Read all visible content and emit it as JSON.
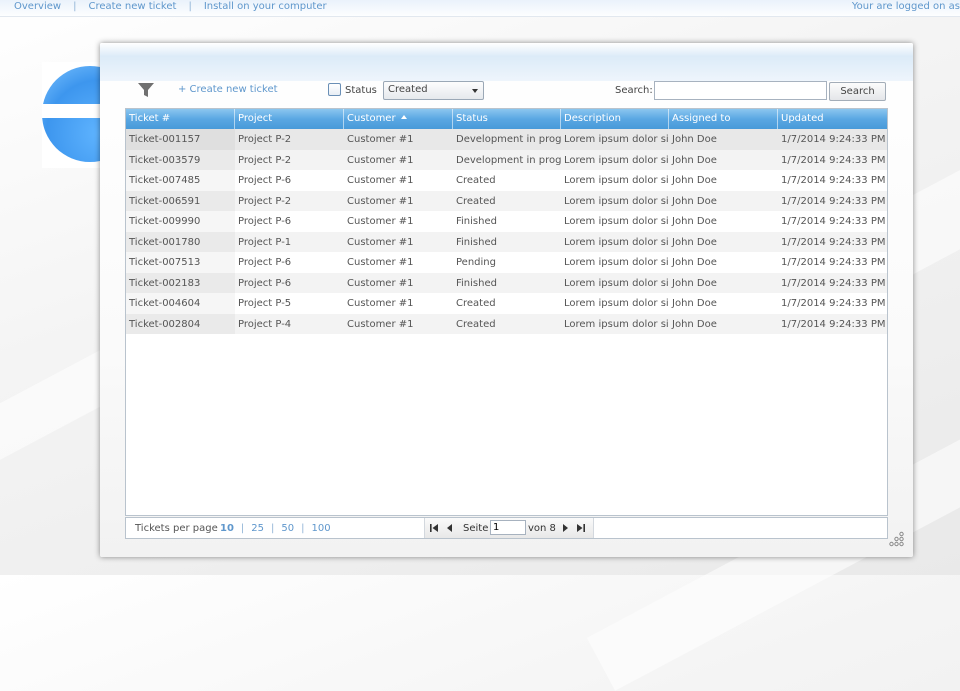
{
  "nav": {
    "links": [
      "Overview",
      "Create new ticket",
      "Install on your computer"
    ],
    "logged_in_text": "Your are logged on as"
  },
  "toolbar": {
    "create_link": "+ Create new ticket",
    "status_label": "Status",
    "status_selected": "Created",
    "search_label": "Search:",
    "search_value": "",
    "search_button": "Search"
  },
  "grid": {
    "columns": [
      "Ticket #",
      "Project",
      "Customer",
      "Status",
      "Description",
      "Assigned to",
      "Updated"
    ],
    "sorted_column": "Customer",
    "rows": [
      [
        "Ticket-001157",
        "Project P-2",
        "Customer #1",
        "Development in progress",
        "Lorem ipsum dolor sit",
        "John Doe",
        "1/7/2014 9:24:33 PM"
      ],
      [
        "Ticket-003579",
        "Project P-2",
        "Customer #1",
        "Development in progress",
        "Lorem ipsum dolor sit",
        "John Doe",
        "1/7/2014 9:24:33 PM"
      ],
      [
        "Ticket-007485",
        "Project P-6",
        "Customer #1",
        "Created",
        "Lorem ipsum dolor sit",
        "John Doe",
        "1/7/2014 9:24:33 PM"
      ],
      [
        "Ticket-006591",
        "Project P-2",
        "Customer #1",
        "Created",
        "Lorem ipsum dolor sit",
        "John Doe",
        "1/7/2014 9:24:33 PM"
      ],
      [
        "Ticket-009990",
        "Project P-6",
        "Customer #1",
        "Finished",
        "Lorem ipsum dolor sit",
        "John Doe",
        "1/7/2014 9:24:33 PM"
      ],
      [
        "Ticket-001780",
        "Project P-1",
        "Customer #1",
        "Finished",
        "Lorem ipsum dolor sit",
        "John Doe",
        "1/7/2014 9:24:33 PM"
      ],
      [
        "Ticket-007513",
        "Project P-6",
        "Customer #1",
        "Pending",
        "Lorem ipsum dolor sit",
        "John Doe",
        "1/7/2014 9:24:33 PM"
      ],
      [
        "Ticket-002183",
        "Project P-6",
        "Customer #1",
        "Finished",
        "Lorem ipsum dolor sit",
        "John Doe",
        "1/7/2014 9:24:33 PM"
      ],
      [
        "Ticket-004604",
        "Project P-5",
        "Customer #1",
        "Created",
        "Lorem ipsum dolor sit",
        "John Doe",
        "1/7/2014 9:24:33 PM"
      ],
      [
        "Ticket-002804",
        "Project P-4",
        "Customer #1",
        "Created",
        "Lorem ipsum dolor sit",
        "John Doe",
        "1/7/2014 9:24:33 PM"
      ]
    ]
  },
  "pager": {
    "per_page_label": "Tickets per page",
    "per_page_options": [
      "10",
      "25",
      "50",
      "100"
    ],
    "per_page_selected": "10",
    "page_label": "Seite",
    "page_value": "1",
    "of_label": "von 8"
  },
  "colors": {
    "link": "#5f97cc",
    "header_blue": "#5aa7e3",
    "logo_blue": "#3d96ee"
  }
}
